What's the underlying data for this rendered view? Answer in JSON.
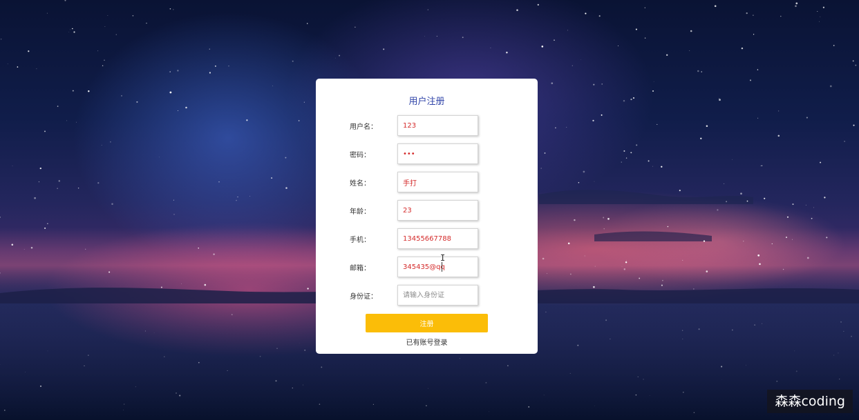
{
  "form": {
    "title": "用户注册",
    "fields": [
      {
        "label": "用户名：",
        "value": "123",
        "placeholder": "",
        "type": "text"
      },
      {
        "label": "密码：",
        "value": "123",
        "placeholder": "",
        "type": "password"
      },
      {
        "label": "姓名：",
        "value": "手打",
        "placeholder": "",
        "type": "text"
      },
      {
        "label": "年龄：",
        "value": "23",
        "placeholder": "",
        "type": "text"
      },
      {
        "label": "手机：",
        "value": "13455667788",
        "placeholder": "",
        "type": "text"
      },
      {
        "label": "邮箱：",
        "value": "345435@qq",
        "placeholder": "",
        "type": "text"
      },
      {
        "label": "身份证：",
        "value": "",
        "placeholder": "请输入身份证",
        "type": "text"
      }
    ],
    "submit_label": "注册",
    "login_link_label": "已有账号登录"
  },
  "watermark": "森森coding",
  "colors": {
    "title": "#2f43a8",
    "input_text": "#d42a2a",
    "button": "#fbbd08",
    "card": "#ffffff"
  }
}
